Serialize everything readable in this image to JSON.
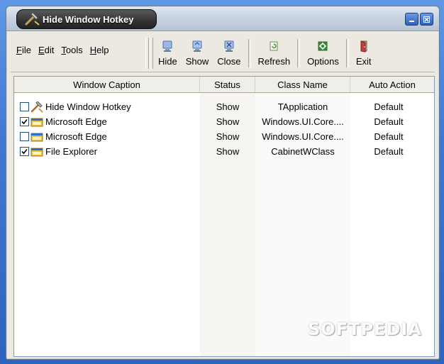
{
  "window": {
    "title": "Hide Window Hotkey",
    "buttons": {
      "minimize": "minimize",
      "close": "close"
    }
  },
  "menu": [
    {
      "accel": "F",
      "rest": "ile"
    },
    {
      "accel": "E",
      "rest": "dit"
    },
    {
      "accel": "T",
      "rest": "ools"
    },
    {
      "accel": "H",
      "rest": "elp"
    }
  ],
  "toolbar": [
    {
      "label": "Hide",
      "icon": "hide-monitor-icon"
    },
    {
      "label": "Show",
      "icon": "show-monitor-icon"
    },
    {
      "label": "Close",
      "icon": "close-monitor-icon"
    },
    {
      "label": "Refresh",
      "icon": "refresh-icon"
    },
    {
      "label": "Options",
      "icon": "options-icon"
    },
    {
      "label": "Exit",
      "icon": "exit-door-icon"
    }
  ],
  "table": {
    "columns": [
      "Window Caption",
      "Status",
      "Class Name",
      "Auto Action"
    ],
    "rows": [
      {
        "checked": false,
        "icon": "hammer-icon",
        "caption": "Hide Window Hotkey",
        "status": "Show",
        "class_name": "TApplication",
        "auto_action": "Default"
      },
      {
        "checked": true,
        "icon": "window-icon",
        "caption": "Microsoft Edge",
        "status": "Show",
        "class_name": "Windows.UI.Core....",
        "auto_action": "Default"
      },
      {
        "checked": false,
        "icon": "window-icon",
        "caption": "Microsoft Edge",
        "status": "Show",
        "class_name": "Windows.UI.Core....",
        "auto_action": "Default"
      },
      {
        "checked": true,
        "icon": "window-icon",
        "caption": "File Explorer",
        "status": "Show",
        "class_name": "CabinetWClass",
        "auto_action": "Default"
      }
    ]
  },
  "watermark": "SOFTPEDIA",
  "colors": {
    "desktop": "#3f7fd8",
    "window_bg": "#eceae0",
    "title_tab": "#333333"
  }
}
